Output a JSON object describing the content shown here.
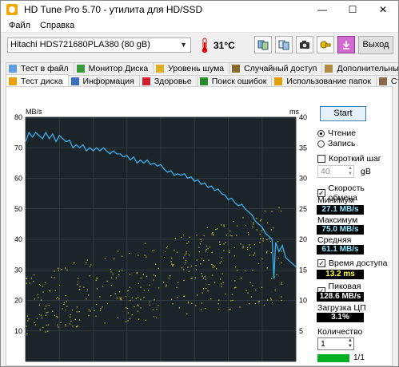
{
  "window": {
    "title": "HD Tune Pro 5.70 - утилита для HD/SSD",
    "minimize": "—",
    "maximize": "☐",
    "close": "✕"
  },
  "menu": {
    "file": "Файл",
    "help": "Справка"
  },
  "toolbar": {
    "drive": "Hitachi HDS721680PLA380 (80 gB)",
    "temperature": "31°C",
    "exit_label": "Выход"
  },
  "tabs_top": [
    "Тест в файл",
    "Монитор Диска",
    "Уровень шума",
    "Случайный доступ",
    "Дополнительные тесты"
  ],
  "tabs_bottom": [
    "Тест диска",
    "Информация",
    "Здоровье",
    "Поиск ошибок",
    "Использование папок",
    "Стирание"
  ],
  "controls": {
    "start_label": "Start",
    "read_label": "Чтение",
    "write_label": "Запись",
    "short_step_label": "Короткий шаг",
    "short_step_value": "40",
    "short_step_unit": "gB",
    "transfer_rate_label": "Скорость обмена",
    "min_label": "Минимум",
    "min_value": "27.1 MB/s",
    "max_label": "Максимум",
    "max_value": "75.0 MB/s",
    "avg_label": "Средняя",
    "avg_value": "61.1 MB/s",
    "access_time_label": "Время доступа",
    "access_time_value": "13.2 ms",
    "burst_label": "Пиковая скорость",
    "burst_value": "128.6 MB/s",
    "cpu_label": "Загрузка ЦП",
    "cpu_value": "3.1%",
    "passes_label": "Количество проходов",
    "passes_value": "1",
    "progress_text": "1/1",
    "progress_fraction": 1.0
  },
  "chart_data": {
    "type": "line",
    "left_axis_label": "MB/s",
    "right_axis_label": "ms",
    "left_ticks": [
      "80",
      "70",
      "60",
      "50",
      "40",
      "30",
      "20",
      "10"
    ],
    "right_ticks": [
      "40",
      "35",
      "30",
      "25",
      "20",
      "15",
      "10",
      "5"
    ],
    "ylim_left": [
      0,
      80
    ],
    "ylim_right": [
      0,
      40
    ],
    "xlim": [
      0,
      80
    ],
    "series": [
      {
        "name": "Transfer rate",
        "color": "#3ab0f0",
        "points": [
          [
            0,
            72
          ],
          [
            1,
            75
          ],
          [
            2,
            73.5
          ],
          [
            3,
            75
          ],
          [
            4,
            74
          ],
          [
            5,
            73
          ],
          [
            6,
            75
          ],
          [
            7,
            73
          ],
          [
            8,
            74.5
          ],
          [
            9,
            72
          ],
          [
            10,
            74
          ],
          [
            11,
            73
          ],
          [
            12,
            72
          ],
          [
            13,
            72.5
          ],
          [
            14,
            70
          ],
          [
            15,
            71
          ],
          [
            16,
            70
          ],
          [
            17,
            71
          ],
          [
            18,
            69
          ],
          [
            19,
            70
          ],
          [
            20,
            69
          ],
          [
            21,
            70
          ],
          [
            22,
            69
          ],
          [
            23,
            70
          ],
          [
            24,
            69
          ],
          [
            25,
            68
          ],
          [
            26,
            69
          ],
          [
            27,
            68
          ],
          [
            28,
            68
          ],
          [
            29,
            67
          ],
          [
            30,
            67.5
          ],
          [
            31,
            66
          ],
          [
            32,
            67
          ],
          [
            33,
            65
          ],
          [
            34,
            66
          ],
          [
            35,
            65
          ],
          [
            36,
            66
          ],
          [
            37,
            64.5
          ],
          [
            38,
            65
          ],
          [
            39,
            64
          ],
          [
            40,
            64.5
          ],
          [
            41,
            63
          ],
          [
            42,
            62
          ],
          [
            43,
            62.5
          ],
          [
            44,
            61
          ],
          [
            45,
            61.5
          ],
          [
            46,
            61
          ],
          [
            47,
            61.5
          ],
          [
            48,
            60
          ],
          [
            49,
            60.5
          ],
          [
            50,
            59
          ],
          [
            51,
            59.5
          ],
          [
            52,
            58
          ],
          [
            53,
            58.5
          ],
          [
            54,
            57
          ],
          [
            55,
            57.5
          ],
          [
            56,
            56
          ],
          [
            57,
            56.5
          ],
          [
            58,
            55
          ],
          [
            59,
            54.5
          ],
          [
            60,
            53
          ],
          [
            61,
            53.5
          ],
          [
            62,
            52
          ],
          [
            63,
            51
          ],
          [
            64,
            51.5
          ],
          [
            65,
            50
          ],
          [
            66,
            49
          ],
          [
            67,
            48
          ],
          [
            68,
            46
          ],
          [
            69,
            45
          ],
          [
            70,
            44
          ],
          [
            71,
            42
          ],
          [
            72,
            41
          ],
          [
            73,
            40
          ],
          [
            73.5,
            27.1
          ],
          [
            74,
            39
          ],
          [
            75,
            36
          ],
          [
            76,
            38
          ],
          [
            77,
            34
          ],
          [
            78,
            33
          ],
          [
            79,
            32
          ],
          [
            80,
            31
          ]
        ]
      },
      {
        "name": "Access time",
        "color": "#e0e030",
        "style": "scatter"
      }
    ]
  },
  "colors": {
    "chart_bg": "#1b2428",
    "grid": "#2e3c41",
    "accent_line": "#3ab0f0",
    "scatter": "#e0e030",
    "stat_text": "#8fe3ff"
  }
}
